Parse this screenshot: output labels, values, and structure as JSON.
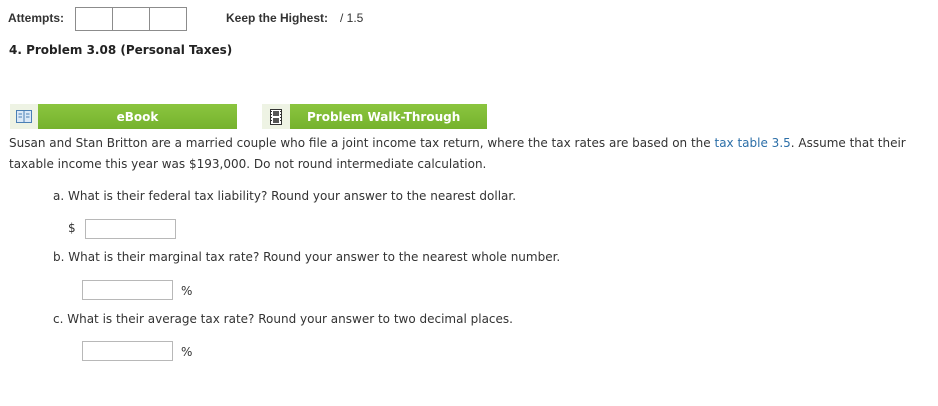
{
  "header": {
    "attempts_label": "Attempts:",
    "attempt_box_count": 3,
    "keep_label": "Keep the Highest:",
    "score": "/ 1.5"
  },
  "problem": {
    "title": "4.  Problem 3.08 (Personal Taxes)"
  },
  "resources": {
    "ebook_label": "eBook",
    "ebook_icon": "book-icon",
    "walkthrough_label": "Problem Walk-Through",
    "walkthrough_icon": "film-icon"
  },
  "text": {
    "intro_before_link": "Susan and Stan Britton are a married couple who file a joint income tax return, where the tax rates are based on the ",
    "link": "tax table 3.5",
    "intro_after_link": ". Assume that their taxable income this year was $193,000. Do not round intermediate calculation."
  },
  "questions": {
    "a": {
      "text": "a. What is their federal tax liability? Round your answer to the nearest dollar.",
      "prefix": "$",
      "value": ""
    },
    "b": {
      "text": "b. What is their marginal tax rate? Round your answer to the nearest whole number.",
      "suffix": "%",
      "value": ""
    },
    "c": {
      "text": "c. What is their average tax rate? Round your answer to two decimal places.",
      "suffix": "%",
      "value": ""
    }
  },
  "colors": {
    "button_green": "#7ab833",
    "link_blue": "#2c6fa8"
  }
}
